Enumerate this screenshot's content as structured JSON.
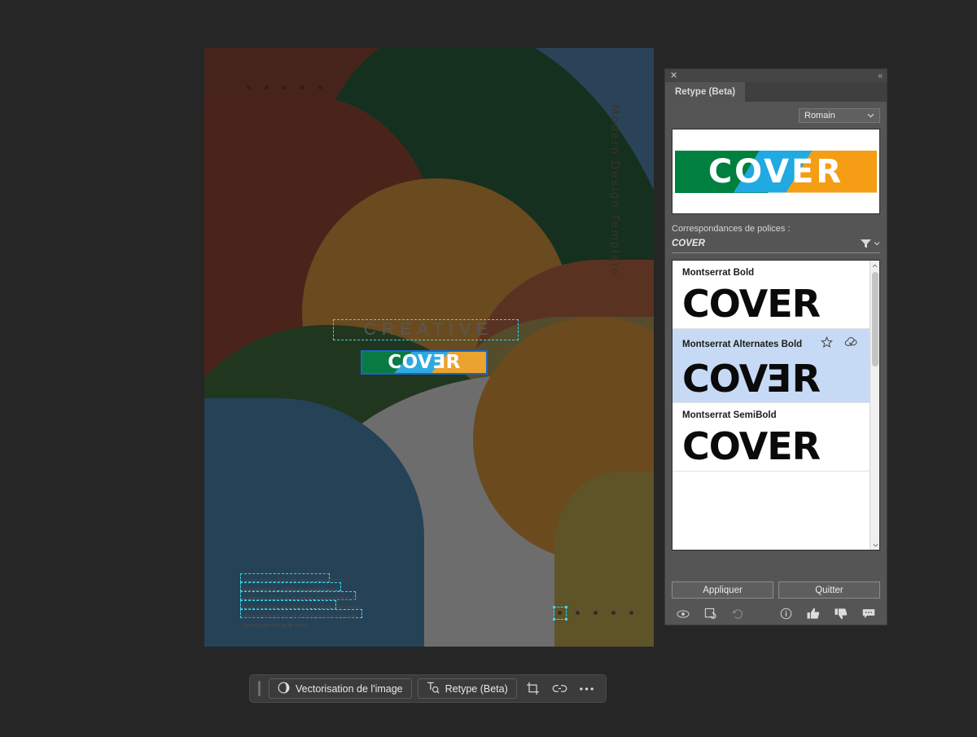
{
  "app": {
    "background_color": "#262626"
  },
  "canvas": {
    "name": "artboard",
    "vertical_label": "Modern Design Template",
    "heading_text": "CREATIVE",
    "logo_text": "COVER",
    "logo_text_parts": {
      "before": "COV",
      "reversed": "E",
      "after": "R"
    },
    "body_paragraph": "Lorem ipsum dolor sit amet, consectetur adipiscing elit, sed do eiusmod tempor incididunt ut labore et dolore magna aliqua. Ut enim ad minim veniam quis nostrud exercitation ullamco laboris nisi ut aliquip ex ea commodo consequat duis aute irure.",
    "top_dots_count": 5,
    "bottom_dots_count": 5,
    "selected_dot_index": 0,
    "selection_color": "#3ad6e8",
    "logo_selection_color": "#1767c8",
    "logo_colors": {
      "green": "#00803f",
      "blue": "#21a9e1",
      "orange": "#f59d14"
    }
  },
  "panel": {
    "close_label": "✕",
    "collapse_label": "«",
    "tab_label": "Retype (Beta)",
    "language_select": {
      "value": "Romain",
      "chevron": "⌄"
    },
    "preview_text": "COVER",
    "matches_label": "Correspondances de polices :",
    "query_text": "COVER",
    "filter_icon": "filter-funnel-icon",
    "font_list": [
      {
        "name": "Montserrat Bold",
        "sample": "COVER",
        "reversed_e": false,
        "selected": false,
        "has_icons": false
      },
      {
        "name": "Montserrat Alternates Bold",
        "sample": "COVER",
        "reversed_e": true,
        "selected": true,
        "has_icons": true
      },
      {
        "name": "Montserrat SemiBold",
        "sample": "COVER",
        "reversed_e": false,
        "selected": false,
        "has_icons": false
      }
    ],
    "apply_label": "Appliquer",
    "quit_label": "Quitter",
    "footer_icons_left": [
      "eye-icon",
      "replace-image-icon",
      "undo-icon"
    ],
    "footer_icons_right": [
      "info-icon",
      "thumbs-up-icon",
      "thumbs-down-icon",
      "comment-icon"
    ]
  },
  "toolbar": {
    "image_trace_label": "Vectorisation de l'image",
    "retype_label": "Retype (Beta)",
    "crop_icon": "crop-icon",
    "link_icon": "link-icon",
    "more_icon": "more-options-icon"
  }
}
